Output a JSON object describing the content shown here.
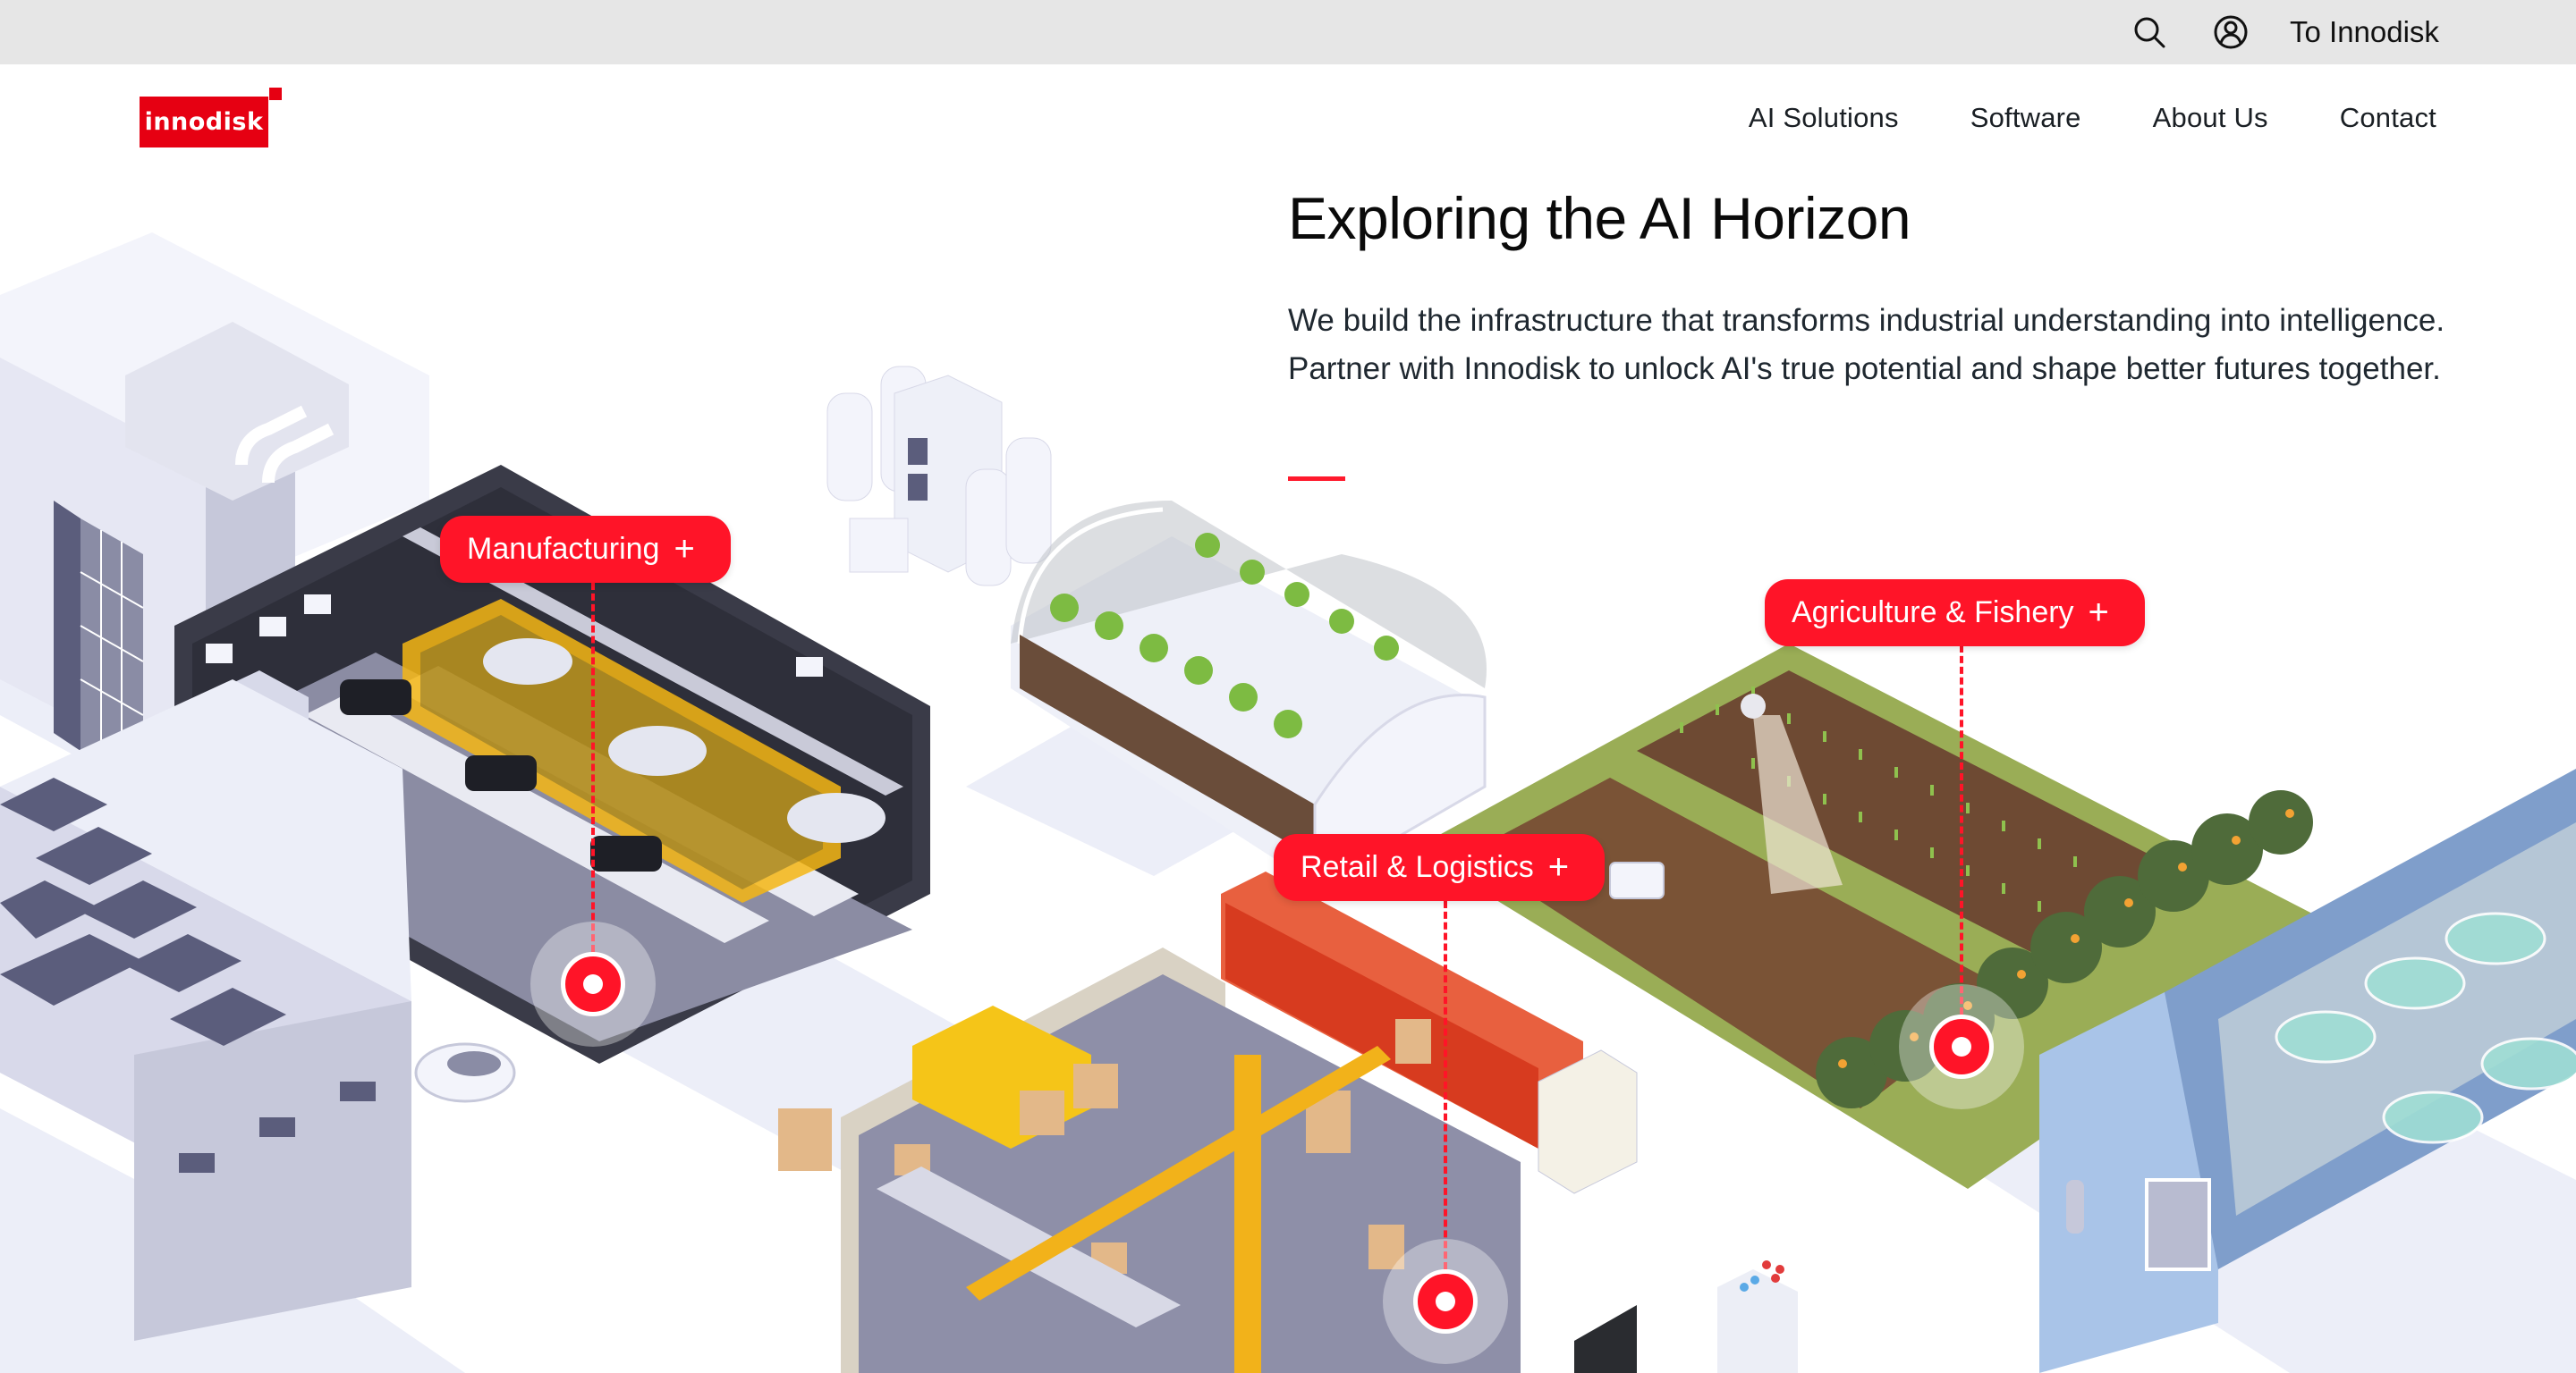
{
  "utility_bar": {
    "search_icon": "search-icon",
    "account_icon": "user-circle-icon",
    "link_label": "To Innodisk"
  },
  "header": {
    "logo_text": "innodisk",
    "nav": [
      {
        "label": "AI Solutions"
      },
      {
        "label": "Software"
      },
      {
        "label": "About Us"
      },
      {
        "label": "Contact"
      }
    ]
  },
  "hero": {
    "title": "Exploring the AI Horizon",
    "body": "We build the infrastructure that transforms industrial understanding into intelligence. Partner with Innodisk to unlock AI's true potential and shape better futures together."
  },
  "hotspots": [
    {
      "label": "Manufacturing",
      "icon": "plus-icon"
    },
    {
      "label": "Agriculture & Fishery",
      "icon": "plus-icon"
    },
    {
      "label": "Retail & Logistics",
      "icon": "plus-icon"
    }
  ],
  "colors": {
    "brand_red": "#e60012",
    "accent_red": "#ff1428",
    "utility_bar_bg": "#e6e6e6",
    "text_dark": "#1a1f24"
  }
}
